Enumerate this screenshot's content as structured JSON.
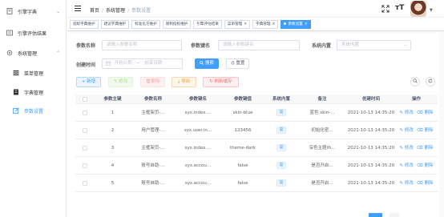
{
  "sidebar": {
    "items": [
      {
        "label": "引擎字典",
        "icon": "dictionary-icon",
        "arrow": "⌄"
      },
      {
        "label": "引擎评估结果",
        "icon": "result-icon"
      },
      {
        "label": "系统管理",
        "icon": "settings-icon",
        "arrow": "⌃"
      },
      {
        "label": "菜单管理",
        "icon": "menu-icon"
      },
      {
        "label": "字典管理",
        "icon": "dict-icon"
      },
      {
        "label": "参数设置",
        "icon": "edit-icon"
      }
    ]
  },
  "header": {
    "breadcrumb": [
      "首页",
      "系统管理",
      "参数设置"
    ],
    "size_label": "тT"
  },
  "tags": [
    {
      "label": "指标字典维护",
      "active": false,
      "closable": false
    },
    {
      "label": "建议字典维护",
      "active": false,
      "closable": false
    },
    {
      "label": "标准化方维护",
      "active": false,
      "closable": false
    },
    {
      "label": "限制指标维护",
      "active": false,
      "closable": false
    },
    {
      "label": "引擎评估结果",
      "active": false,
      "closable": false
    },
    {
      "label": "菜单管理",
      "active": false,
      "closable": true
    },
    {
      "label": "字典管理",
      "active": false,
      "closable": true
    },
    {
      "label": "参数设置",
      "active": true,
      "closable": true
    }
  ],
  "search": {
    "param_name_label": "参数名称",
    "param_name_placeholder": "请输入参数名称",
    "param_key_label": "参数键名",
    "param_key_placeholder": "请输入参数键名",
    "builtin_label": "系统内置",
    "builtin_placeholder": "系统内置",
    "created_label": "创建时间",
    "start_placeholder": "开始日期",
    "date_sep": "-",
    "end_placeholder": "结束日期",
    "search_btn": "搜索",
    "reset_btn": "重置"
  },
  "toolbar": {
    "add": "新增",
    "edit": "修改",
    "delete": "删除",
    "export": "导出",
    "refresh_cache": "刷新缓存"
  },
  "table": {
    "headers": [
      "参数主键",
      "参数名称",
      "参数键名",
      "参数键值",
      "系统内置",
      "备注",
      "创建时间",
      "操作"
    ],
    "edit_label": "修改",
    "delete_label": "删除",
    "rows": [
      {
        "id": "1",
        "name": "主框架页-...",
        "key": "sys.index....",
        "value": "skin-blue",
        "builtin": "是",
        "remark": "蓝色 skin-...",
        "time": "2021-10-13 14:35:20"
      },
      {
        "id": "2",
        "name": "用户管理-...",
        "key": "sys.user.in...",
        "value": "123456",
        "builtin": "是",
        "remark": "初始化密...",
        "time": "2021-10-13 14:35:20"
      },
      {
        "id": "3",
        "name": "主框架页-...",
        "key": "sys.index....",
        "value": "theme-dark",
        "builtin": "是",
        "remark": "深色主题th...",
        "time": "2021-10-13 14:35:20"
      },
      {
        "id": "4",
        "name": "账号自助-...",
        "key": "sys.accou...",
        "value": "false",
        "builtin": "是",
        "remark": "是否开启...",
        "time": "2021-10-13 14:35:20"
      },
      {
        "id": "5",
        "name": "账号自助-...",
        "key": "sys.accou...",
        "value": "false",
        "builtin": "是",
        "remark": "是否开启...",
        "time": "2021-10-13 14:35:20"
      }
    ]
  },
  "colors": {
    "primary": "#409eff",
    "danger": "#f56c6c",
    "warning": "#e6a23c",
    "success": "#67c23a"
  }
}
